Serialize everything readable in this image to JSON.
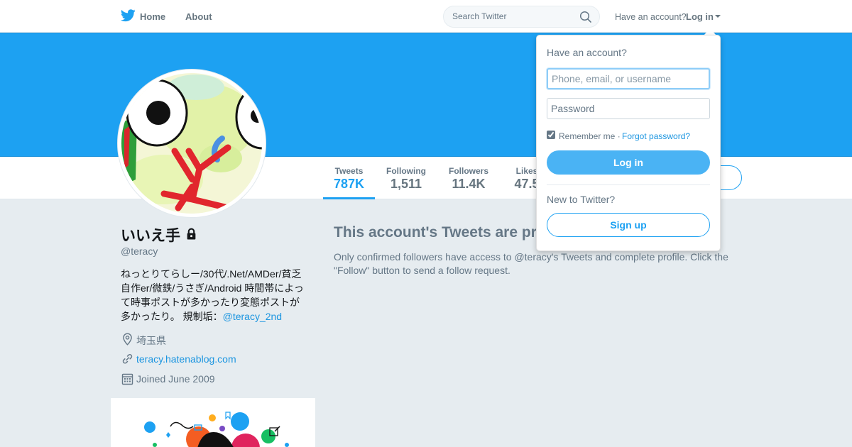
{
  "nav": {
    "home": "Home",
    "about": "About",
    "search_placeholder": "Search Twitter",
    "have_account": "Have an account?",
    "login": "Log in"
  },
  "stats": [
    {
      "label": "Tweets",
      "value": "787K"
    },
    {
      "label": "Following",
      "value": "1,511"
    },
    {
      "label": "Followers",
      "value": "11.4K"
    },
    {
      "label": "Likes",
      "value": "47.5"
    }
  ],
  "profile": {
    "name": "いいえ手",
    "handle": "@teracy",
    "bio": "ねっとりてらしー/30代/.Net/AMDer/貧乏自作er/微鉄/うさぎ/Android 時間帯によって時事ポストが多かったり変態ポストが多かったり。 規制垢：",
    "bio_link": "@teracy_2nd",
    "location": "埼玉県",
    "url": "teracy.hatenablog.com",
    "joined": "Joined June 2009"
  },
  "protected": {
    "title": "This account's Tweets are protected.",
    "body": "Only confirmed followers have access to @teracy's Tweets and complete profile. Click the \"Follow\" button to send a follow request."
  },
  "login_dropdown": {
    "heading": "Have an account?",
    "username_placeholder": "Phone, email, or username",
    "password_placeholder": "Password",
    "remember": "Remember me",
    "separator": "·",
    "forgot": "Forgot password?",
    "login_button": "Log in",
    "new_to": "New to Twitter?",
    "signup_button": "Sign up"
  },
  "colors": {
    "brand": "#1da1f2",
    "link": "#1b95e0",
    "muted": "#657786",
    "page_bg": "#e6ecf0"
  },
  "icons": [
    "twitter-bird-icon",
    "search-icon",
    "caret-down-icon",
    "lock-icon",
    "location-pin-icon",
    "link-icon",
    "calendar-icon"
  ]
}
